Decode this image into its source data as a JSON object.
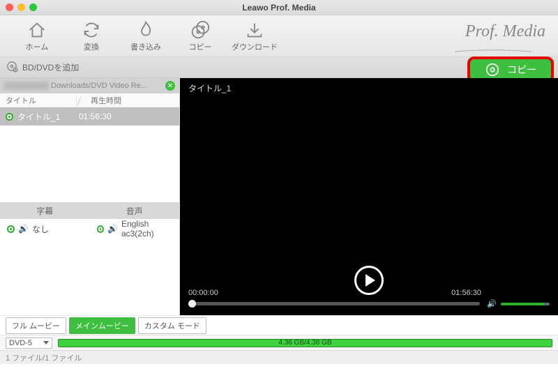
{
  "window": {
    "title": "Leawo Prof. Media"
  },
  "brand": "Prof. Media",
  "nav": {
    "home": "ホーム",
    "convert": "変換",
    "burn": "書き込み",
    "copy": "コピー",
    "download": "ダウンロード"
  },
  "secbar": {
    "add_label": "BD/DVDを追加",
    "copy_label": "コピー"
  },
  "source": {
    "path": "Downloads/DVD Video Re..."
  },
  "columns": {
    "title": "タイトル",
    "duration": "再生時間"
  },
  "titles": [
    {
      "name": "タイトル_1",
      "duration": "01:56:30"
    }
  ],
  "subheaders": {
    "subtitle": "字幕",
    "audio": "音声"
  },
  "tracks": {
    "subtitle": "なし",
    "audio": "English ac3(2ch)"
  },
  "preview": {
    "title": "タイトル_1",
    "current": "00:00:00",
    "total": "01:56:30"
  },
  "modes": {
    "full": "フル ムービー",
    "main": "メインムービー",
    "custom": "カスタム モード"
  },
  "disc": {
    "type": "DVD-5",
    "capacity": "4.36 GB/4.38 GB"
  },
  "status": "1 ファイル/1 ファイル"
}
